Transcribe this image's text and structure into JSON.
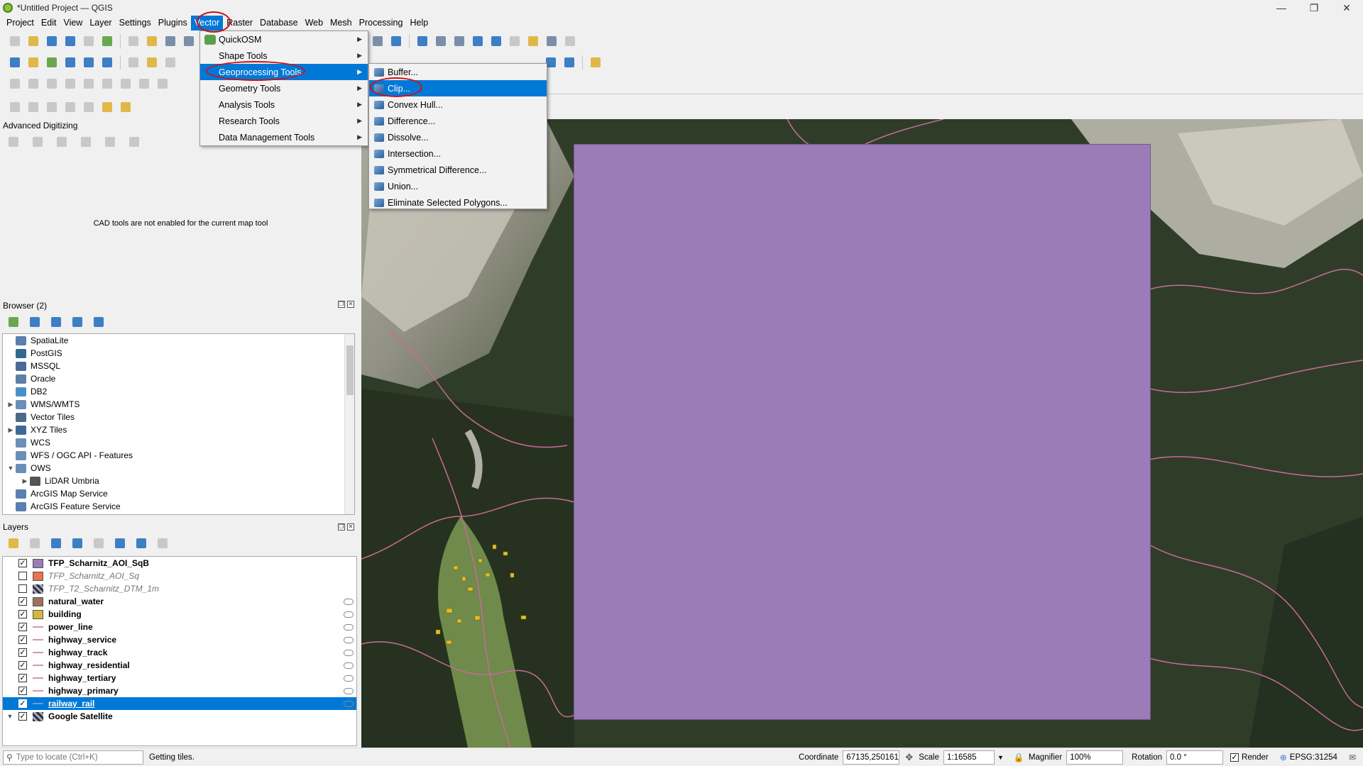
{
  "window": {
    "title": "*Untitled Project — QGIS",
    "controls": [
      "—",
      "❐",
      "✕"
    ]
  },
  "menubar": {
    "items": [
      "Project",
      "Edit",
      "View",
      "Layer",
      "Settings",
      "Plugins",
      "Vector",
      "Raster",
      "Database",
      "Web",
      "Mesh",
      "Processing",
      "Help"
    ],
    "active": "Vector"
  },
  "vector_menu": {
    "items": [
      {
        "label": "QuickOSM",
        "icon": "quickosm-icon"
      },
      {
        "label": "Shape Tools",
        "icon": ""
      },
      {
        "label": "Geoprocessing Tools",
        "icon": "",
        "highlighted": true
      },
      {
        "label": "Geometry Tools",
        "icon": ""
      },
      {
        "label": "Analysis Tools",
        "icon": ""
      },
      {
        "label": "Research Tools",
        "icon": ""
      },
      {
        "label": "Data Management Tools",
        "icon": ""
      }
    ]
  },
  "geoprocessing_menu": {
    "items": [
      {
        "label": "Buffer...",
        "highlighted": false
      },
      {
        "label": "Clip...",
        "highlighted": true
      },
      {
        "label": "Convex Hull...",
        "highlighted": false
      },
      {
        "label": "Difference...",
        "highlighted": false
      },
      {
        "label": "Dissolve...",
        "highlighted": false
      },
      {
        "label": "Intersection...",
        "highlighted": false
      },
      {
        "label": "Symmetrical Difference...",
        "highlighted": false
      },
      {
        "label": "Union...",
        "highlighted": false
      },
      {
        "label": "Eliminate Selected Polygons...",
        "highlighted": false
      }
    ]
  },
  "advanced_digitizing": {
    "title": "Advanced Digitizing",
    "message": "CAD tools are not enabled for the current map tool"
  },
  "browser": {
    "title": "Browser (2)",
    "items": [
      {
        "label": "SpatiaLite",
        "expandable": false,
        "expanded": false,
        "indent": 0,
        "icon": "spatialite-icon",
        "color": "#5a7fb0"
      },
      {
        "label": "PostGIS",
        "expandable": false,
        "expanded": false,
        "indent": 0,
        "icon": "postgis-icon",
        "color": "#336791"
      },
      {
        "label": "MSSQL",
        "expandable": false,
        "expanded": false,
        "indent": 0,
        "icon": "mssql-icon",
        "color": "#4a6a9a"
      },
      {
        "label": "Oracle",
        "expandable": false,
        "expanded": false,
        "indent": 0,
        "icon": "oracle-icon",
        "color": "#5b7fa6"
      },
      {
        "label": "DB2",
        "expandable": false,
        "expanded": false,
        "indent": 0,
        "icon": "db2-icon",
        "color": "#4a90c8"
      },
      {
        "label": "WMS/WMTS",
        "expandable": true,
        "expanded": false,
        "indent": 0,
        "icon": "wms-icon",
        "color": "#6a8fb8"
      },
      {
        "label": "Vector Tiles",
        "expandable": false,
        "expanded": false,
        "indent": 0,
        "icon": "vector-tiles-icon",
        "color": "#4a6a8a"
      },
      {
        "label": "XYZ Tiles",
        "expandable": true,
        "expanded": false,
        "indent": 0,
        "icon": "xyz-tiles-icon",
        "color": "#3d6a9a"
      },
      {
        "label": "WCS",
        "expandable": false,
        "expanded": false,
        "indent": 0,
        "icon": "wcs-icon",
        "color": "#6a8fb8"
      },
      {
        "label": "WFS / OGC API - Features",
        "expandable": false,
        "expanded": false,
        "indent": 0,
        "icon": "wfs-icon",
        "color": "#6a8fb8"
      },
      {
        "label": "OWS",
        "expandable": true,
        "expanded": true,
        "indent": 0,
        "icon": "ows-icon",
        "color": "#6a8fb8"
      },
      {
        "label": "LiDAR Umbria",
        "expandable": true,
        "expanded": false,
        "indent": 1,
        "icon": "lidar-icon",
        "color": "#555555"
      },
      {
        "label": "ArcGIS Map Service",
        "expandable": false,
        "expanded": false,
        "indent": 0,
        "icon": "arcgis-map-icon",
        "color": "#5a7fb0"
      },
      {
        "label": "ArcGIS Feature Service",
        "expandable": false,
        "expanded": false,
        "indent": 0,
        "icon": "arcgis-feature-icon",
        "color": "#5a7fb0"
      }
    ]
  },
  "layers": {
    "title": "Layers",
    "items": [
      {
        "name": "TFP_Scharnitz_AOI_SqB",
        "checked": true,
        "style": "bold",
        "symbol": "fill",
        "color": "#9b7bb8",
        "eye": false,
        "selected": false,
        "expandable": false
      },
      {
        "name": "TFP_Scharnitz_AOI_Sq",
        "checked": false,
        "style": "italic",
        "symbol": "fill",
        "color": "#e8744a",
        "eye": false,
        "selected": false,
        "expandable": false
      },
      {
        "name": "TFP_T2_Scharnitz_DTM_1m",
        "checked": false,
        "style": "italic",
        "symbol": "raster",
        "color": "#333333",
        "eye": false,
        "selected": false,
        "expandable": false
      },
      {
        "name": "natural_water",
        "checked": true,
        "style": "bold",
        "symbol": "fill",
        "color": "#a0705a",
        "eye": true,
        "selected": false,
        "expandable": false
      },
      {
        "name": "building",
        "checked": true,
        "style": "bold",
        "symbol": "fill",
        "color": "#d4b83a",
        "eye": true,
        "selected": false,
        "expandable": false
      },
      {
        "name": "power_line",
        "checked": true,
        "style": "bold",
        "symbol": "line",
        "color": "#d69aa0",
        "eye": true,
        "selected": false,
        "expandable": false
      },
      {
        "name": "highway_service",
        "checked": true,
        "style": "bold",
        "symbol": "line",
        "color": "#d69aa0",
        "eye": true,
        "selected": false,
        "expandable": false
      },
      {
        "name": "highway_track",
        "checked": true,
        "style": "bold",
        "symbol": "line",
        "color": "#d69aa0",
        "eye": true,
        "selected": false,
        "expandable": false
      },
      {
        "name": "highway_residential",
        "checked": true,
        "style": "bold",
        "symbol": "line",
        "color": "#d69aa0",
        "eye": true,
        "selected": false,
        "expandable": false
      },
      {
        "name": "highway_tertiary",
        "checked": true,
        "style": "bold",
        "symbol": "line",
        "color": "#d69aa0",
        "eye": true,
        "selected": false,
        "expandable": false
      },
      {
        "name": "highway_primary",
        "checked": true,
        "style": "bold",
        "symbol": "line",
        "color": "#d69aa0",
        "eye": true,
        "selected": false,
        "expandable": false
      },
      {
        "name": "railway_rail",
        "checked": true,
        "style": "bold",
        "symbol": "line",
        "color": "#6a9fd8",
        "eye": true,
        "selected": true,
        "expandable": false
      },
      {
        "name": "Google Satellite",
        "checked": true,
        "style": "bold",
        "symbol": "raster",
        "color": "#333333",
        "eye": false,
        "selected": false,
        "expandable": true
      }
    ]
  },
  "statusbar": {
    "locator_placeholder": "Type to locate (Ctrl+K)",
    "message": "Getting tiles.",
    "coordinate_label": "Coordinate",
    "coordinate_value": "67135,250161",
    "scale_label": "Scale",
    "scale_value": "1:16585",
    "magnifier_label": "Magnifier",
    "magnifier_value": "100%",
    "rotation_label": "Rotation",
    "rotation_value": "0.0 °",
    "render_label": "Render",
    "crs": "EPSG:31254"
  },
  "colors": {
    "accent": "#0078d7",
    "annotation_ring": "#d01010",
    "aoi_fill": "#9b7bb8"
  }
}
